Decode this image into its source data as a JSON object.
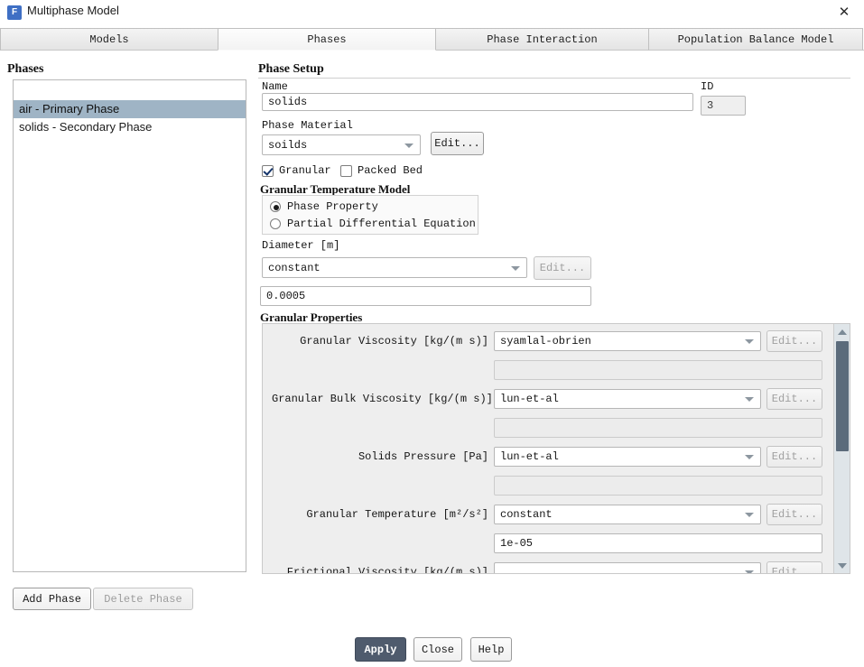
{
  "window": {
    "title": "Multiphase Model",
    "app_icon": "fluent-f-icon",
    "close_icon": "close-icon",
    "close_label": "✕"
  },
  "tabs": [
    {
      "label": "Models",
      "active": false
    },
    {
      "label": "Phases",
      "active": true
    },
    {
      "label": "Phase Interaction",
      "active": false
    },
    {
      "label": "Population Balance Model",
      "active": false
    }
  ],
  "phases_panel": {
    "heading": "Phases",
    "items": [
      {
        "label": "air - Primary Phase",
        "selected": true
      },
      {
        "label": "solids - Secondary Phase",
        "selected": false
      }
    ],
    "add_button": "Add Phase",
    "delete_button": "Delete Phase"
  },
  "phase_setup": {
    "heading": "Phase Setup",
    "name_label": "Name",
    "name_value": "solids",
    "id_label": "ID",
    "id_value": "3",
    "material_label": "Phase Material",
    "material_value": "soilds",
    "material_edit": "Edit...",
    "granular_checkbox_label": "Granular",
    "granular_checked": true,
    "packed_bed_checkbox_label": "Packed Bed",
    "packed_bed_checked": false,
    "granular_temp_model_title": "Granular Temperature Model",
    "granular_temp_options": [
      {
        "label": "Phase Property",
        "selected": true
      },
      {
        "label": "Partial Differential Equation",
        "selected": false
      }
    ],
    "diameter_label": "Diameter [m]",
    "diameter_method": "constant",
    "diameter_edit": "Edit...",
    "diameter_value": "0.0005"
  },
  "granular_properties": {
    "title": "Granular Properties",
    "edit_label": "Edit...",
    "rows": [
      {
        "label": "Granular Viscosity [kg/(m s)]",
        "method": "syamlal-obrien",
        "value": ""
      },
      {
        "label": "Granular Bulk Viscosity [kg/(m s)]",
        "method": "lun-et-al",
        "value": ""
      },
      {
        "label": "Solids Pressure [Pa]",
        "method": "lun-et-al",
        "value": ""
      },
      {
        "label": "Granular Temperature [m²/s²]",
        "method": "constant",
        "value": "1e-05"
      },
      {
        "label": "Frictional Viscosity [kg/(m s)]",
        "method": "",
        "value": ""
      }
    ]
  },
  "actions": {
    "apply": "Apply",
    "close": "Close",
    "help": "Help"
  },
  "colors": {
    "accent": "#4f5b6d",
    "selection": "#9fb4c5",
    "app_icon": "#3f6fc4",
    "scroll_thumb": "#5b6b7b"
  }
}
